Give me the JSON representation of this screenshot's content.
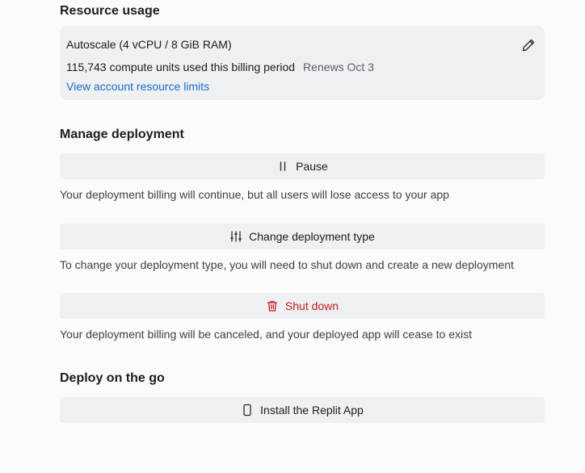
{
  "resource": {
    "title": "Resource usage",
    "plan": "Autoscale (4 vCPU / 8 GiB RAM)",
    "usage": "115,743 compute units used this billing period",
    "renews": "Renews Oct 3",
    "limits_link": "View account resource limits",
    "edit_icon": "pencil-icon"
  },
  "manage": {
    "title": "Manage deployment",
    "pause": {
      "label": "Pause",
      "icon": "pause-icon",
      "desc": "Your deployment billing will continue, but all users will lose access to your app"
    },
    "change_type": {
      "label": "Change deployment type",
      "icon": "sliders-icon",
      "desc": "To change your deployment type, you will need to shut down and create a new deployment"
    },
    "shutdown": {
      "label": "Shut down",
      "icon": "trash-icon",
      "desc": "Your deployment billing will be canceled, and your deployed app will cease to exist",
      "color": "#c21d1d"
    }
  },
  "go": {
    "title": "Deploy on the go",
    "install": {
      "label": "Install the Replit App",
      "icon": "phone-icon"
    }
  },
  "colors": {
    "link": "#1a6cc8",
    "card_bg": "#eff0f2",
    "danger": "#c21d1d"
  }
}
